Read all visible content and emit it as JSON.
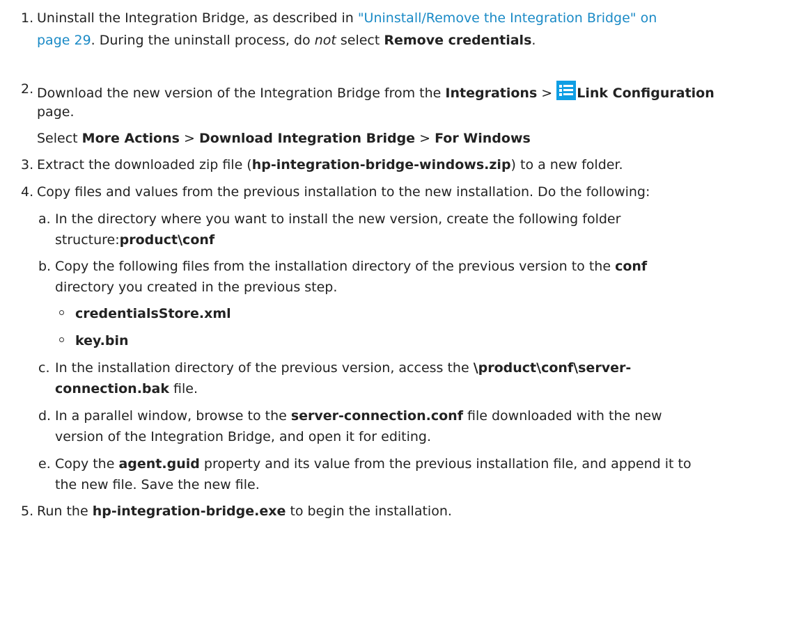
{
  "steps": {
    "s1": {
      "num": "1.",
      "pre": "Uninstall the Integration Bridge, as described in ",
      "link_a": "\"Uninstall/Remove the Integration Bridge\" on",
      "link_b": "page 29",
      "mid": ". During the uninstall process, do ",
      "not": "not",
      "mid2": " select ",
      "remove_credentials": "Remove credentials",
      "end": "."
    },
    "s2": {
      "num": "2.",
      "pre": "Download the new version of the Integration Bridge from the ",
      "integrations": "Integrations",
      "gt": " > ",
      "link_config": "Link Configuration",
      "page": "page.",
      "select_pre": "Select ",
      "more_actions": "More Actions",
      "download_bridge": "Download Integration Bridge",
      "for_windows": "For Windows"
    },
    "s3": {
      "num": "3.",
      "pre": "Extract the downloaded zip file (",
      "zip": "hp-integration-bridge-windows.zip",
      "post": ") to a new folder."
    },
    "s4": {
      "num": "4.",
      "text": "Copy files and values from the previous installation to the new installation. Do the following:",
      "a": {
        "label": "a.",
        "line1": "In the directory where you want to install the new version, create the following folder",
        "line2_pre": "structure:",
        "folder": "product\\conf"
      },
      "b": {
        "label": "b.",
        "line1_pre": "Copy the following files from the installation directory of the previous version to the ",
        "conf": "conf",
        "line2": "directory you created in the previous step.",
        "files": [
          "credentialsStore.xml",
          "key.bin"
        ]
      },
      "c": {
        "label": "c.",
        "line1_pre": "In the installation directory of the previous version, access the ",
        "path_a": "\\product\\conf\\server-",
        "path_b": "connection.bak",
        "post": " file."
      },
      "d": {
        "label": "d.",
        "line1_pre": "In a parallel window, browse to the ",
        "file": "server-connection.conf",
        "line1_post": " file downloaded with the new",
        "line2": "version of the Integration Bridge, and open it for editing."
      },
      "e": {
        "label": "e.",
        "line1_pre": "Copy the ",
        "prop": "agent.guid",
        "line1_post": " property and its value from the previous installation file, and append it to",
        "line2": "the new file. Save the new file."
      }
    },
    "s5": {
      "num": "5.",
      "pre": "Run the ",
      "exe": "hp-integration-bridge.exe",
      "post": " to begin the installation."
    }
  },
  "icons": {
    "link_configuration": "list-icon"
  },
  "colors": {
    "link": "#1a8ac6",
    "icon": "#0f9ee4",
    "text": "#222222"
  }
}
